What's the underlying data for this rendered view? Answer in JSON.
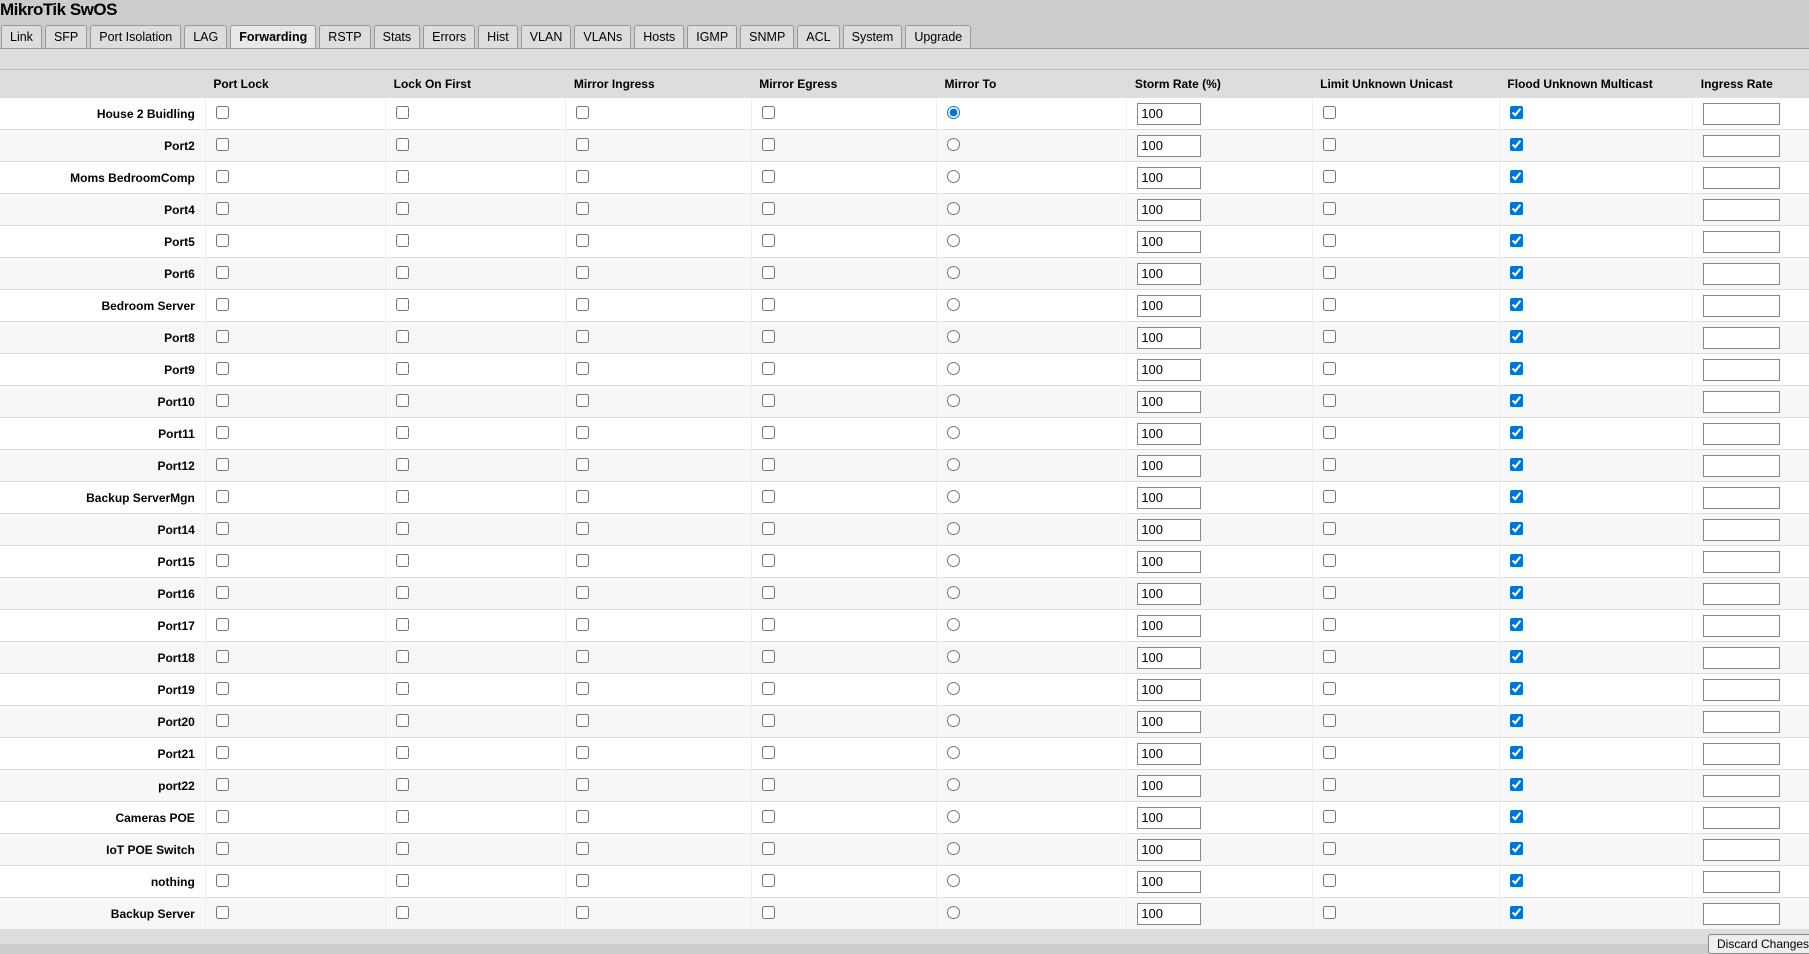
{
  "app_title": "MikroTik SwOS",
  "tabs": [
    "Link",
    "SFP",
    "Port Isolation",
    "LAG",
    "Forwarding",
    "RSTP",
    "Stats",
    "Errors",
    "Hist",
    "VLAN",
    "VLANs",
    "Hosts",
    "IGMP",
    "SNMP",
    "ACL",
    "System",
    "Upgrade"
  ],
  "active_tab": "Forwarding",
  "columns": [
    "",
    "Port Lock",
    "Lock On First",
    "Mirror Ingress",
    "Mirror Egress",
    "Mirror To",
    "Storm Rate (%)",
    "Limit Unknown Unicast",
    "Flood Unknown Multicast",
    "Ingress Rate"
  ],
  "ports": [
    "House 2 Buidling",
    "Port2",
    "Moms BedroomComp",
    "Port4",
    "Port5",
    "Port6",
    "Bedroom Server",
    "Port8",
    "Port9",
    "Port10",
    "Port11",
    "Port12",
    "Backup ServerMgn",
    "Port14",
    "Port15",
    "Port16",
    "Port17",
    "Port18",
    "Port19",
    "Port20",
    "Port21",
    "port22",
    "Cameras POE",
    "IoT POE Switch",
    "nothing",
    "Backup Server"
  ],
  "defaults": {
    "port_lock": false,
    "lock_on_first": false,
    "mirror_ingress": false,
    "mirror_egress": false,
    "storm_rate": "100",
    "limit_unknown_unicast": false,
    "flood_unknown_multicast": true,
    "ingress_rate": ""
  },
  "mirror_to_index": 0,
  "discard_label": "Discard Changes"
}
